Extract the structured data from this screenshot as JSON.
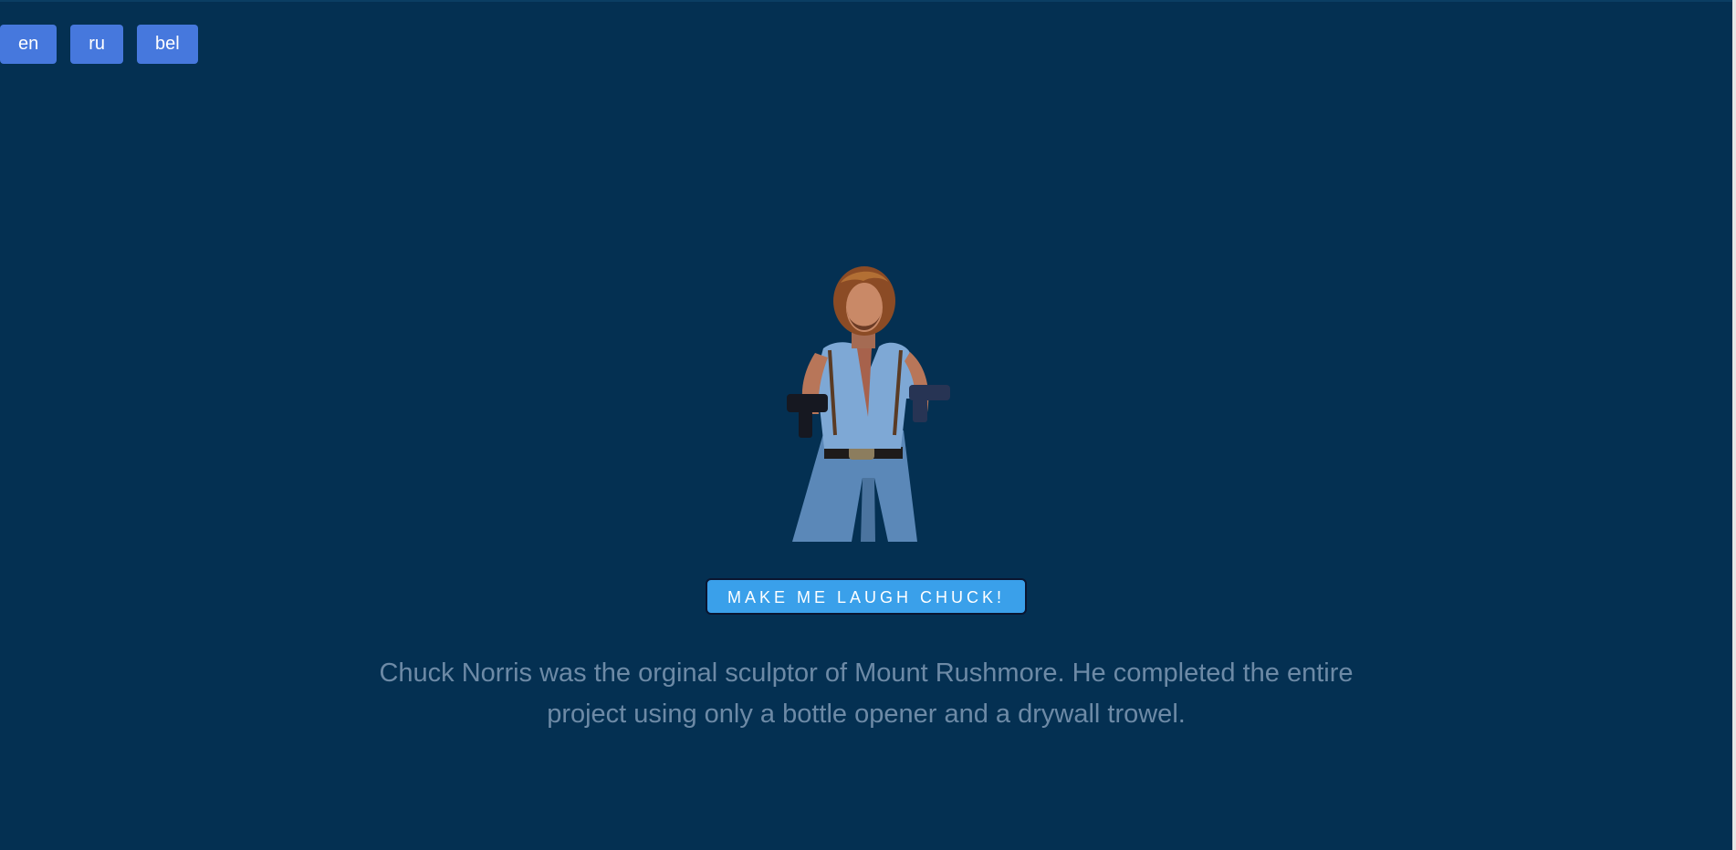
{
  "languages": [
    {
      "label": "en"
    },
    {
      "label": "ru"
    },
    {
      "label": "bel"
    }
  ],
  "action": {
    "label": "MAKE ME LAUGH CHUCK!"
  },
  "joke": {
    "text": "Chuck Norris was the orginal sculptor of Mount Rushmore. He completed the entire project using only a bottle opener and a drywall trowel."
  },
  "colors": {
    "background": "#043052",
    "language_button": "#4678dd",
    "action_button": "#3aa0ea",
    "joke_text": "#6d8aa6"
  },
  "image": {
    "icon": "chuck-norris-photo"
  }
}
